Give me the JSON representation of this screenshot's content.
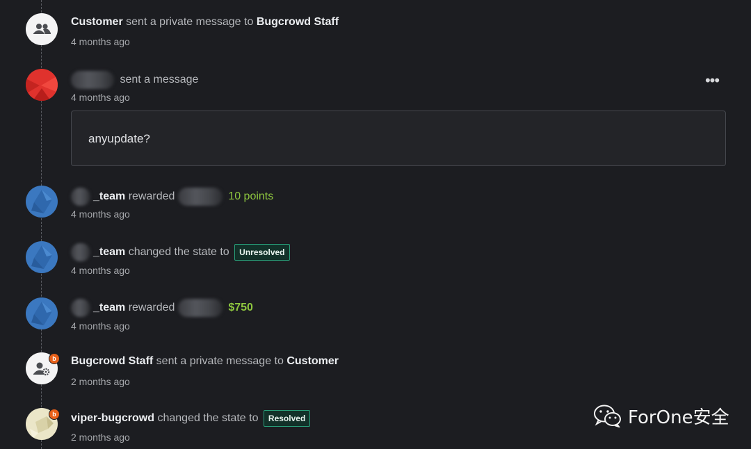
{
  "events": [
    {
      "actor": "Customer",
      "action": "sent a private message to",
      "target": "Bugcrowd Staff",
      "time": "4 months ago",
      "avatar_icon": "users-group-icon"
    },
    {
      "action": "sent a message",
      "time": "4 months ago",
      "avatar_icon": "red-geometric-avatar",
      "message": "anyupdate?",
      "more_label": "•••"
    },
    {
      "actor": "_team",
      "action": "rewarded",
      "reward": "10 points",
      "time": "4 months ago",
      "avatar_icon": "blue-geometric-avatar"
    },
    {
      "actor": "_team",
      "action": "changed the state to",
      "state": "Unresolved",
      "time": "4 months ago",
      "avatar_icon": "blue-geometric-avatar"
    },
    {
      "actor": "_team",
      "action": "rewarded",
      "reward": "$750",
      "time": "4 months ago",
      "avatar_icon": "blue-geometric-avatar"
    },
    {
      "actor": "Bugcrowd Staff",
      "action": "sent a private message to",
      "target": "Customer",
      "time": "2 months ago",
      "avatar_icon": "user-gear-icon",
      "badge": "b"
    },
    {
      "actor": "viper-bugcrowd",
      "action": "changed the state to",
      "state": "Resolved",
      "time": "2 months ago",
      "avatar_icon": "beige-geometric-avatar",
      "badge": "b"
    }
  ],
  "watermark": {
    "text": "ForOne安全",
    "icon": "wechat-icon"
  },
  "colors": {
    "background": "#1c1d21",
    "reward_green": "#8ec63f",
    "state_border": "#28a07a",
    "badge_orange": "#e8611a"
  }
}
